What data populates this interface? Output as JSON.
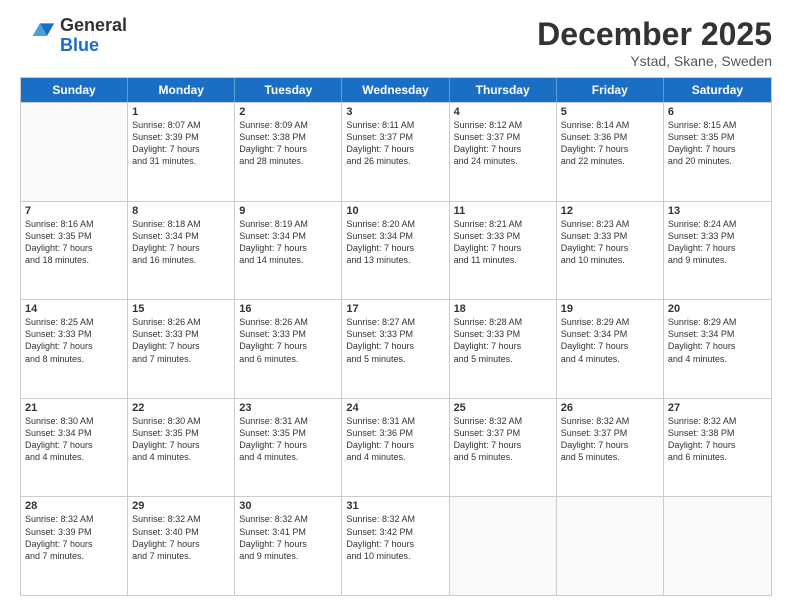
{
  "logo": {
    "general": "General",
    "blue": "Blue"
  },
  "header": {
    "month": "December 2025",
    "location": "Ystad, Skane, Sweden"
  },
  "days": [
    "Sunday",
    "Monday",
    "Tuesday",
    "Wednesday",
    "Thursday",
    "Friday",
    "Saturday"
  ],
  "weeks": [
    [
      {
        "day": "",
        "info": ""
      },
      {
        "day": "1",
        "info": "Sunrise: 8:07 AM\nSunset: 3:39 PM\nDaylight: 7 hours\nand 31 minutes."
      },
      {
        "day": "2",
        "info": "Sunrise: 8:09 AM\nSunset: 3:38 PM\nDaylight: 7 hours\nand 28 minutes."
      },
      {
        "day": "3",
        "info": "Sunrise: 8:11 AM\nSunset: 3:37 PM\nDaylight: 7 hours\nand 26 minutes."
      },
      {
        "day": "4",
        "info": "Sunrise: 8:12 AM\nSunset: 3:37 PM\nDaylight: 7 hours\nand 24 minutes."
      },
      {
        "day": "5",
        "info": "Sunrise: 8:14 AM\nSunset: 3:36 PM\nDaylight: 7 hours\nand 22 minutes."
      },
      {
        "day": "6",
        "info": "Sunrise: 8:15 AM\nSunset: 3:35 PM\nDaylight: 7 hours\nand 20 minutes."
      }
    ],
    [
      {
        "day": "7",
        "info": "Sunrise: 8:16 AM\nSunset: 3:35 PM\nDaylight: 7 hours\nand 18 minutes."
      },
      {
        "day": "8",
        "info": "Sunrise: 8:18 AM\nSunset: 3:34 PM\nDaylight: 7 hours\nand 16 minutes."
      },
      {
        "day": "9",
        "info": "Sunrise: 8:19 AM\nSunset: 3:34 PM\nDaylight: 7 hours\nand 14 minutes."
      },
      {
        "day": "10",
        "info": "Sunrise: 8:20 AM\nSunset: 3:34 PM\nDaylight: 7 hours\nand 13 minutes."
      },
      {
        "day": "11",
        "info": "Sunrise: 8:21 AM\nSunset: 3:33 PM\nDaylight: 7 hours\nand 11 minutes."
      },
      {
        "day": "12",
        "info": "Sunrise: 8:23 AM\nSunset: 3:33 PM\nDaylight: 7 hours\nand 10 minutes."
      },
      {
        "day": "13",
        "info": "Sunrise: 8:24 AM\nSunset: 3:33 PM\nDaylight: 7 hours\nand 9 minutes."
      }
    ],
    [
      {
        "day": "14",
        "info": "Sunrise: 8:25 AM\nSunset: 3:33 PM\nDaylight: 7 hours\nand 8 minutes."
      },
      {
        "day": "15",
        "info": "Sunrise: 8:26 AM\nSunset: 3:33 PM\nDaylight: 7 hours\nand 7 minutes."
      },
      {
        "day": "16",
        "info": "Sunrise: 8:26 AM\nSunset: 3:33 PM\nDaylight: 7 hours\nand 6 minutes."
      },
      {
        "day": "17",
        "info": "Sunrise: 8:27 AM\nSunset: 3:33 PM\nDaylight: 7 hours\nand 5 minutes."
      },
      {
        "day": "18",
        "info": "Sunrise: 8:28 AM\nSunset: 3:33 PM\nDaylight: 7 hours\nand 5 minutes."
      },
      {
        "day": "19",
        "info": "Sunrise: 8:29 AM\nSunset: 3:34 PM\nDaylight: 7 hours\nand 4 minutes."
      },
      {
        "day": "20",
        "info": "Sunrise: 8:29 AM\nSunset: 3:34 PM\nDaylight: 7 hours\nand 4 minutes."
      }
    ],
    [
      {
        "day": "21",
        "info": "Sunrise: 8:30 AM\nSunset: 3:34 PM\nDaylight: 7 hours\nand 4 minutes."
      },
      {
        "day": "22",
        "info": "Sunrise: 8:30 AM\nSunset: 3:35 PM\nDaylight: 7 hours\nand 4 minutes."
      },
      {
        "day": "23",
        "info": "Sunrise: 8:31 AM\nSunset: 3:35 PM\nDaylight: 7 hours\nand 4 minutes."
      },
      {
        "day": "24",
        "info": "Sunrise: 8:31 AM\nSunset: 3:36 PM\nDaylight: 7 hours\nand 4 minutes."
      },
      {
        "day": "25",
        "info": "Sunrise: 8:32 AM\nSunset: 3:37 PM\nDaylight: 7 hours\nand 5 minutes."
      },
      {
        "day": "26",
        "info": "Sunrise: 8:32 AM\nSunset: 3:37 PM\nDaylight: 7 hours\nand 5 minutes."
      },
      {
        "day": "27",
        "info": "Sunrise: 8:32 AM\nSunset: 3:38 PM\nDaylight: 7 hours\nand 6 minutes."
      }
    ],
    [
      {
        "day": "28",
        "info": "Sunrise: 8:32 AM\nSunset: 3:39 PM\nDaylight: 7 hours\nand 7 minutes."
      },
      {
        "day": "29",
        "info": "Sunrise: 8:32 AM\nSunset: 3:40 PM\nDaylight: 7 hours\nand 7 minutes."
      },
      {
        "day": "30",
        "info": "Sunrise: 8:32 AM\nSunset: 3:41 PM\nDaylight: 7 hours\nand 9 minutes."
      },
      {
        "day": "31",
        "info": "Sunrise: 8:32 AM\nSunset: 3:42 PM\nDaylight: 7 hours\nand 10 minutes."
      },
      {
        "day": "",
        "info": ""
      },
      {
        "day": "",
        "info": ""
      },
      {
        "day": "",
        "info": ""
      }
    ]
  ]
}
